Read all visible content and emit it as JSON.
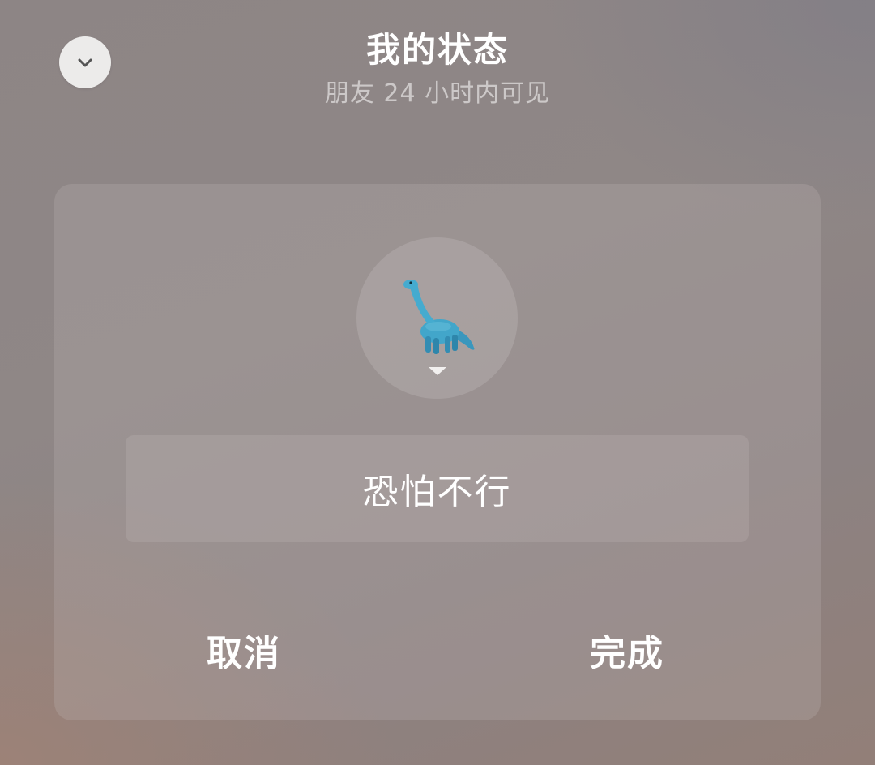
{
  "header": {
    "title": "我的状态",
    "subtitle": "朋友 24 小时内可见",
    "collapse_icon": "chevron-down-icon"
  },
  "status_card": {
    "emoji_icon": "sauropod-dinosaur-icon",
    "emoji_dropdown_icon": "caret-down-icon",
    "status_text": "恐怕不行",
    "cancel_label": "取消",
    "done_label": "完成"
  },
  "colors": {
    "text": "#ffffff",
    "collapse_button_bg": "#ecebea",
    "dinosaur": "#3fa3c6"
  }
}
